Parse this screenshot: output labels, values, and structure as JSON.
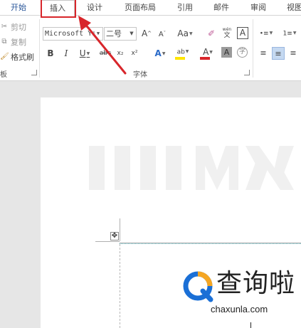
{
  "tabs": [
    {
      "label": "开始"
    },
    {
      "label": "插入"
    },
    {
      "label": "设计"
    },
    {
      "label": "页面布局"
    },
    {
      "label": "引用"
    },
    {
      "label": "邮件"
    },
    {
      "label": "审阅"
    },
    {
      "label": "视图"
    }
  ],
  "clipboard": {
    "cut_label": "剪切",
    "copy_label": "复制",
    "painter_label": "格式刷",
    "group_label": "板"
  },
  "font": {
    "group_label": "字体",
    "name_value": "Microsoft Ya",
    "size_value": "二号",
    "grow_label": "A",
    "shrink_label": "A",
    "case_label": "Aa",
    "phonetic_label": "wén",
    "border_label": "A",
    "bold_label": "B",
    "italic_label": "I",
    "underline_label": "U",
    "strike_label": "abc",
    "subscript_label": "x₂",
    "superscript_label": "x²",
    "effects_label": "A",
    "highlight_label": "ab",
    "color_label": "A",
    "shading_label": "A",
    "enclose_label": "字",
    "highlight_color": "#ffe500",
    "font_color": "#d8262b"
  },
  "branding": {
    "name": "查询啦",
    "url": "chaxunla.com",
    "accent_blue": "#1a6fd6",
    "accent_orange": "#f5a623"
  },
  "annotation": {
    "highlight_color": "#d8262b"
  }
}
